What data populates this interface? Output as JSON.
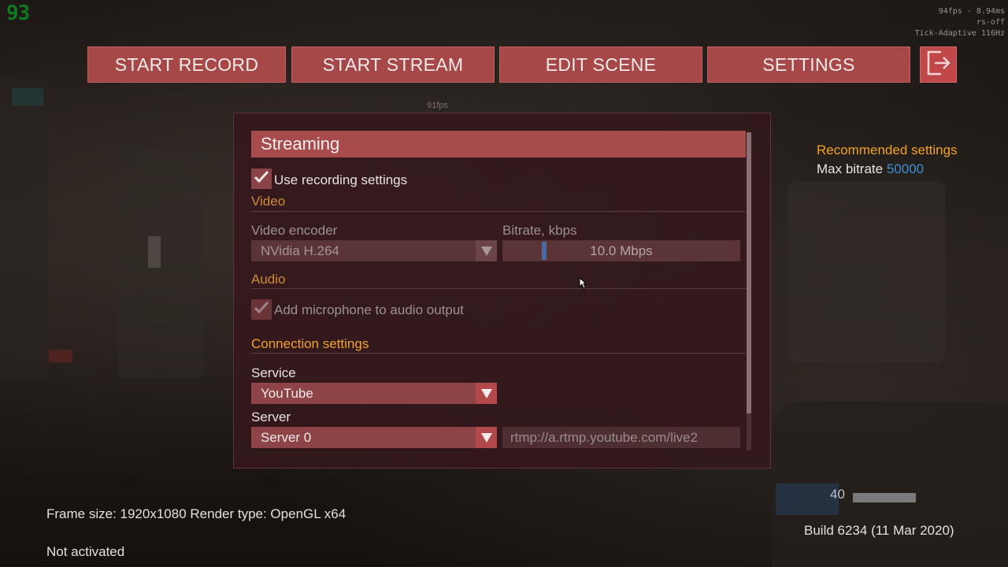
{
  "overlay": {
    "fps_counter": "93",
    "debug_lines": [
      "94fps - 8.94ms",
      "rs-off",
      "Tick-Adaptive 116Hz"
    ],
    "fps_mid": "91fps"
  },
  "toolbar": {
    "start_record": "START RECORD",
    "start_stream": "START STREAM",
    "edit_scene": "EDIT SCENE",
    "settings": "SETTINGS",
    "exit_icon": "exit-icon"
  },
  "panel": {
    "title": "Streaming",
    "use_recording_settings": {
      "label": "Use recording settings",
      "checked": true
    },
    "video_section": "Video",
    "video_encoder": {
      "label": "Video encoder",
      "value": "NVidia H.264"
    },
    "bitrate": {
      "label": "Bitrate, kbps",
      "value": "10.0 Mbps"
    },
    "audio_section": "Audio",
    "add_microphone": {
      "label": "Add microphone to audio output",
      "checked": true
    },
    "connection_section": "Connection settings",
    "service": {
      "label": "Service",
      "value": "YouTube"
    },
    "server": {
      "label": "Server",
      "value": "Server 0",
      "url": "rtmp://a.rtmp.youtube.com/live2"
    }
  },
  "recommended": {
    "title": "Recommended settings",
    "max_bitrate_label": "Max bitrate",
    "max_bitrate_value": "50000"
  },
  "footer": {
    "frame_info": "Frame size: 1920x1080 Render type: OpenGL x64",
    "activation": "Not activated",
    "build": "Build 6234 (11 Mar 2020)"
  },
  "hud": {
    "ammo": "40"
  },
  "colors": {
    "button": "#a64748",
    "exit_button": "#c04849",
    "panel_header": "#a84b4c",
    "section_orange": "#f0a22a",
    "accent_blue": "#3d8fd6"
  }
}
